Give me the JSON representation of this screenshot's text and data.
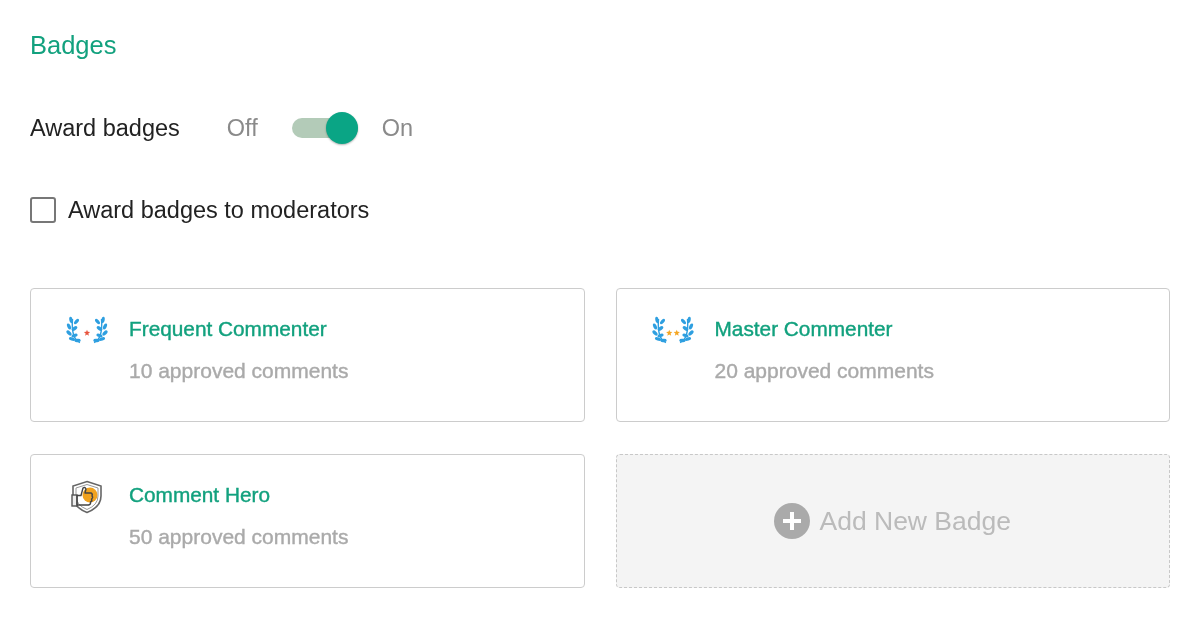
{
  "section_title": "Badges",
  "award_toggle": {
    "label": "Award badges",
    "off_label": "Off",
    "on_label": "On",
    "on": true
  },
  "moderators_checkbox": {
    "label": "Award badges to moderators",
    "checked": false
  },
  "badges": [
    {
      "kind": "onestar",
      "title": "Frequent Commenter",
      "requirement": "10 approved comments"
    },
    {
      "kind": "twostar",
      "title": "Master Commenter",
      "requirement": "20 approved comments"
    },
    {
      "kind": "shield",
      "title": "Comment Hero",
      "requirement": "50 approved comments"
    }
  ],
  "add_badge": {
    "label": "Add New Badge"
  }
}
